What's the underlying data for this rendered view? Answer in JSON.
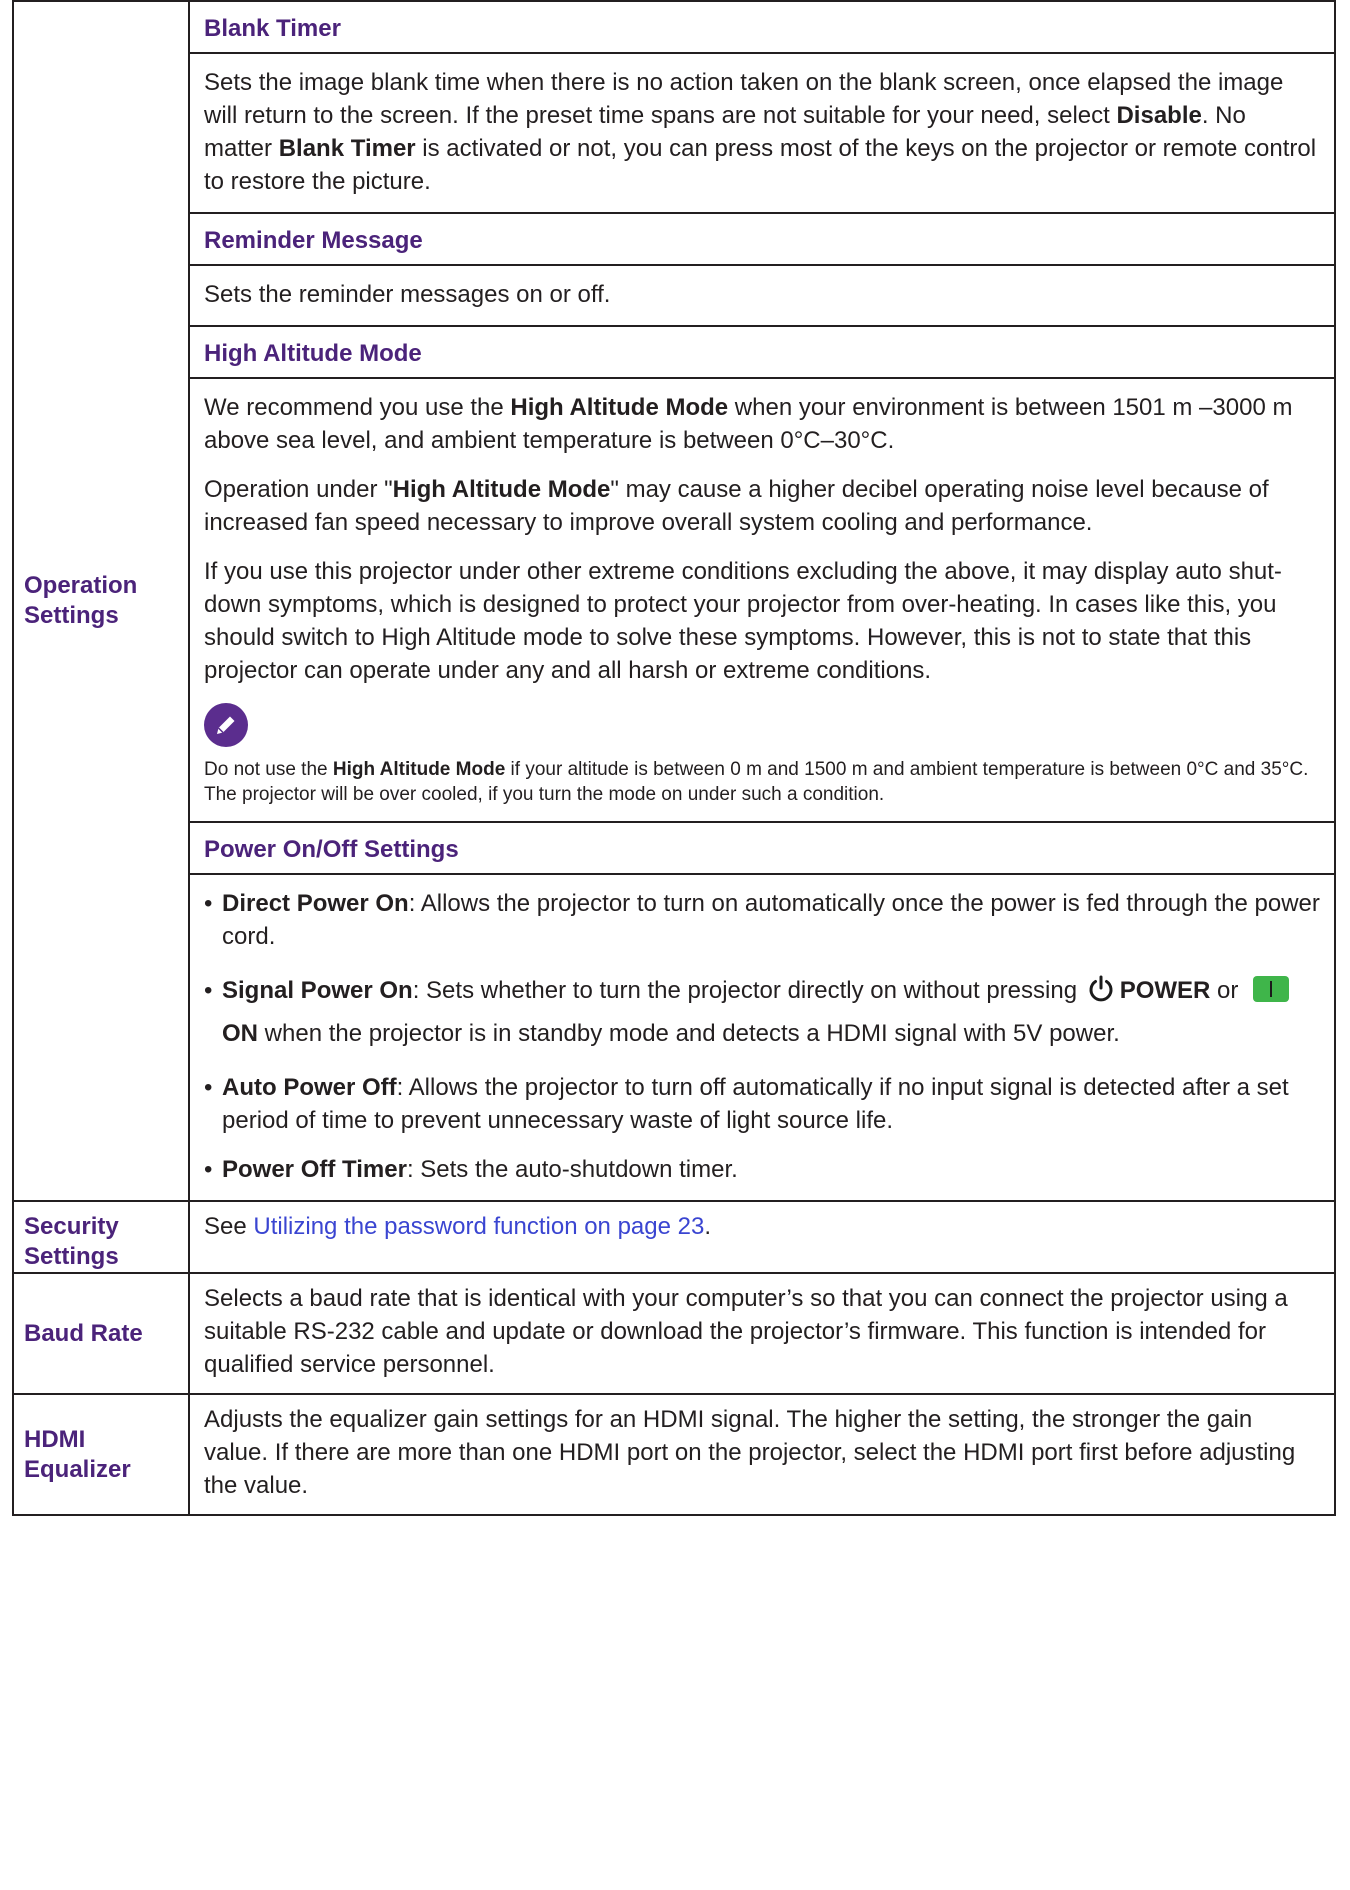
{
  "operation": {
    "label": "Operation Settings",
    "blank_timer": {
      "title": "Blank Timer",
      "text_1": "Sets the image blank time when there is no action taken on the blank screen, once elapsed the image will return to the screen. If the preset time spans are not suitable for your need, select ",
      "bold_1": "Disable",
      "text_2": ". No matter ",
      "bold_2": "Blank Timer",
      "text_3": " is activated or not, you can press most of the keys on the projector or remote control to restore the picture."
    },
    "reminder": {
      "title": "Reminder Message",
      "text": "Sets the reminder messages on or off."
    },
    "high_altitude": {
      "title": "High Altitude Mode",
      "p1_a": "We recommend you use the ",
      "p1_b": "High Altitude Mode",
      "p1_c": " when your environment is between 1501 m –3000 m above sea level, and ambient temperature is between 0°C–30°C.",
      "p2_a": "Operation under \"",
      "p2_b": "High Altitude Mode",
      "p2_c": "\" may cause a higher decibel operating noise level because of increased fan speed necessary to improve overall system cooling and performance.",
      "p3": "If you use this projector under other extreme conditions excluding the above, it may display auto shut-down symptoms, which is designed to protect your projector from over-heating. In cases like this, you should switch to High Altitude mode to solve these symptoms. However, this is not to state that this projector can operate under any and all harsh or extreme conditions.",
      "note_icon": "pencil-note-icon",
      "note_a": "Do not use the ",
      "note_b": "High Altitude Mode",
      "note_c": " if your altitude is between 0 m and 1500 m and ambient temperature is between 0°C and 35°C. The projector will be over cooled, if you turn the mode on under such a condition."
    },
    "power": {
      "title": "Power On/Off Settings",
      "bullet_char": "•",
      "b1_title": "Direct Power On",
      "b1_text": ": Allows the projector to turn on automatically once the power is fed through the power cord.",
      "b2_title": "Signal Power On",
      "b2_text_1": ": Sets whether to turn the projector directly on without pressing ",
      "b2_power": "POWER",
      "b2_or": " or ",
      "b2_on": "ON",
      "b2_text_2": " when the projector is in standby mode and detects a HDMI signal with 5V power.",
      "b3_title": "Auto Power Off",
      "b3_text": ": Allows the projector to turn off automatically if no input signal is detected after a set period of time to prevent unnecessary waste of light source life.",
      "b4_title": "Power Off Timer",
      "b4_text": ": Sets the auto-shutdown timer.",
      "power_icon": "power-icon",
      "on_icon": "on-key-icon",
      "on_color": "#3fb54a"
    }
  },
  "security": {
    "label": "Security Settings",
    "text": "See ",
    "link": "Utilizing the password function on page 23",
    "end": "."
  },
  "baud": {
    "label": "Baud Rate",
    "text": "Selects a baud rate that is identical with your computer’s so that you can connect the projector using a suitable RS-232 cable and update or download the projector’s firmware. This function is intended for qualified service personnel."
  },
  "hdmi": {
    "label": "HDMI Equalizer",
    "text": "Adjusts the equalizer gain settings for an HDMI signal. The higher the setting, the stronger the gain value. If there are more than one HDMI port on the projector, select the HDMI port first before adjusting the value."
  },
  "colors": {
    "heading": "#4b237a",
    "link": "#3a45d1",
    "border": "#231f20",
    "text": "#231f20"
  }
}
